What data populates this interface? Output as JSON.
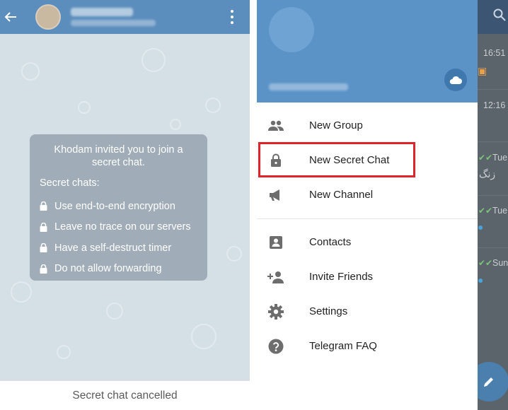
{
  "chat": {
    "secret_card": {
      "invite_text": "Khodam invited you to join a secret chat.",
      "heading": "Secret chats:",
      "features": [
        "Use end-to-end encryption",
        "Leave no trace on our servers",
        "Have a self-destruct timer",
        "Do not allow forwarding"
      ]
    },
    "status_text": "Secret chat cancelled"
  },
  "drawer": {
    "menu": [
      {
        "label": "New Group",
        "icon": "group-icon"
      },
      {
        "label": "New Secret Chat",
        "icon": "lock-icon"
      },
      {
        "label": "New Channel",
        "icon": "megaphone-icon"
      },
      {
        "label": "Contacts",
        "icon": "contact-card-icon"
      },
      {
        "label": "Invite Friends",
        "icon": "add-person-icon"
      },
      {
        "label": "Settings",
        "icon": "gear-icon"
      },
      {
        "label": "Telegram FAQ",
        "icon": "help-icon"
      }
    ],
    "highlight_color": "#e0222a"
  },
  "background_list": {
    "times": [
      "16:51",
      "12:16",
      "Tue",
      "Tue",
      "Sun"
    ],
    "snippet": "زنگ"
  },
  "colors": {
    "appbar": "#5b8dbd",
    "drawer_header": "#5b93c7",
    "accent": "#4b7fae"
  }
}
